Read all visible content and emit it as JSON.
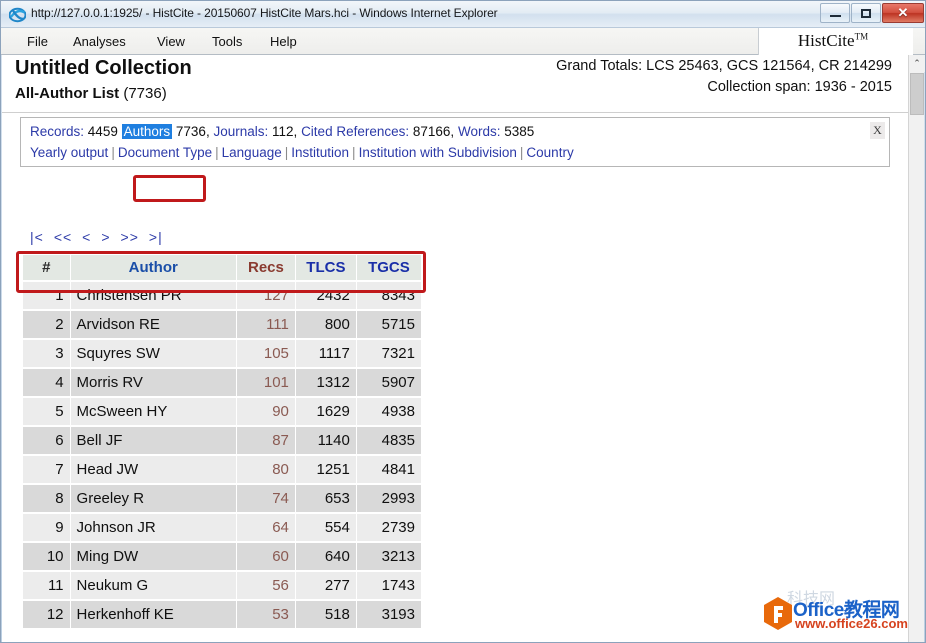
{
  "window": {
    "title": "http://127.0.0.1:1925/ - HistCite - 20150607 HistCite Mars.hci - Windows Internet Explorer",
    "ghost_text": "",
    "minimize_label": "",
    "maximize_label": "",
    "close_label": "✕"
  },
  "menubar": {
    "items": [
      {
        "label": "File"
      },
      {
        "label": "Analyses"
      },
      {
        "label": "View"
      },
      {
        "label": "Tools"
      },
      {
        "label": "Help"
      }
    ],
    "brand": "HistCite",
    "brand_sup": "TM"
  },
  "header": {
    "collection_title": "Untitled Collection",
    "list_label": "All-Author List",
    "list_count": "(7736)",
    "grand_totals": "Grand Totals: LCS 25463, GCS 121564, CR 214299",
    "collection_span": "Collection span: 1936 - 2015"
  },
  "records_panel": {
    "records_label": "Records:",
    "records_value": "4459",
    "authors_label": "Authors",
    "authors_value": "7736,",
    "journals_label": "Journals:",
    "journals_value": "112,",
    "cited_refs_label": "Cited References:",
    "cited_refs_value": "87166,",
    "words_label": "Words:",
    "words_value": "5385",
    "close_label": "X",
    "links": [
      {
        "label": "Yearly output"
      },
      {
        "label": "Document Type"
      },
      {
        "label": "Language"
      },
      {
        "label": "Institution"
      },
      {
        "label": "Institution with Subdivision"
      },
      {
        "label": "Country"
      }
    ],
    "link_separator": "|"
  },
  "pager": {
    "first": "|<",
    "prev_block": "<<",
    "prev": "<",
    "next": ">",
    "next_block": ">>",
    "last": ">|"
  },
  "table": {
    "columns": [
      {
        "key": "num",
        "label": "#"
      },
      {
        "key": "auth",
        "label": "Author"
      },
      {
        "key": "recs",
        "label": "Recs"
      },
      {
        "key": "tlcs",
        "label": "TLCS"
      },
      {
        "key": "tgcs",
        "label": "TGCS"
      }
    ],
    "rows": [
      {
        "num": "1",
        "auth": "Christensen PR",
        "recs": "127",
        "tlcs": "2432",
        "tgcs": "8343"
      },
      {
        "num": "2",
        "auth": "Arvidson RE",
        "recs": "111",
        "tlcs": "800",
        "tgcs": "5715"
      },
      {
        "num": "3",
        "auth": "Squyres SW",
        "recs": "105",
        "tlcs": "1117",
        "tgcs": "7321"
      },
      {
        "num": "4",
        "auth": "Morris RV",
        "recs": "101",
        "tlcs": "1312",
        "tgcs": "5907"
      },
      {
        "num": "5",
        "auth": "McSween HY",
        "recs": "90",
        "tlcs": "1629",
        "tgcs": "4938"
      },
      {
        "num": "6",
        "auth": "Bell JF",
        "recs": "87",
        "tlcs": "1140",
        "tgcs": "4835"
      },
      {
        "num": "7",
        "auth": "Head JW",
        "recs": "80",
        "tlcs": "1251",
        "tgcs": "4841"
      },
      {
        "num": "8",
        "auth": "Greeley R",
        "recs": "74",
        "tlcs": "653",
        "tgcs": "2993"
      },
      {
        "num": "9",
        "auth": "Johnson JR",
        "recs": "64",
        "tlcs": "554",
        "tgcs": "2739"
      },
      {
        "num": "10",
        "auth": "Ming DW",
        "recs": "60",
        "tlcs": "640",
        "tgcs": "3213"
      },
      {
        "num": "11",
        "auth": "Neukum G",
        "recs": "56",
        "tlcs": "277",
        "tgcs": "1743"
      },
      {
        "num": "12",
        "auth": "Herkenhoff KE",
        "recs": "53",
        "tlcs": "518",
        "tgcs": "3193"
      }
    ]
  },
  "scrollbar": {
    "up_arrow": "⌃"
  },
  "watermark": {
    "title": "Office教程网",
    "url": "www.office26.com",
    "ghost": "科技网"
  },
  "colors": {
    "annotation_red": "#c0191b",
    "link_blue": "#2c3aa8",
    "highlight_blue": "#1f7fe0",
    "recs_header": "#8a3b30",
    "watermark_blue": "#1b62c8",
    "watermark_red": "#d6431f"
  }
}
